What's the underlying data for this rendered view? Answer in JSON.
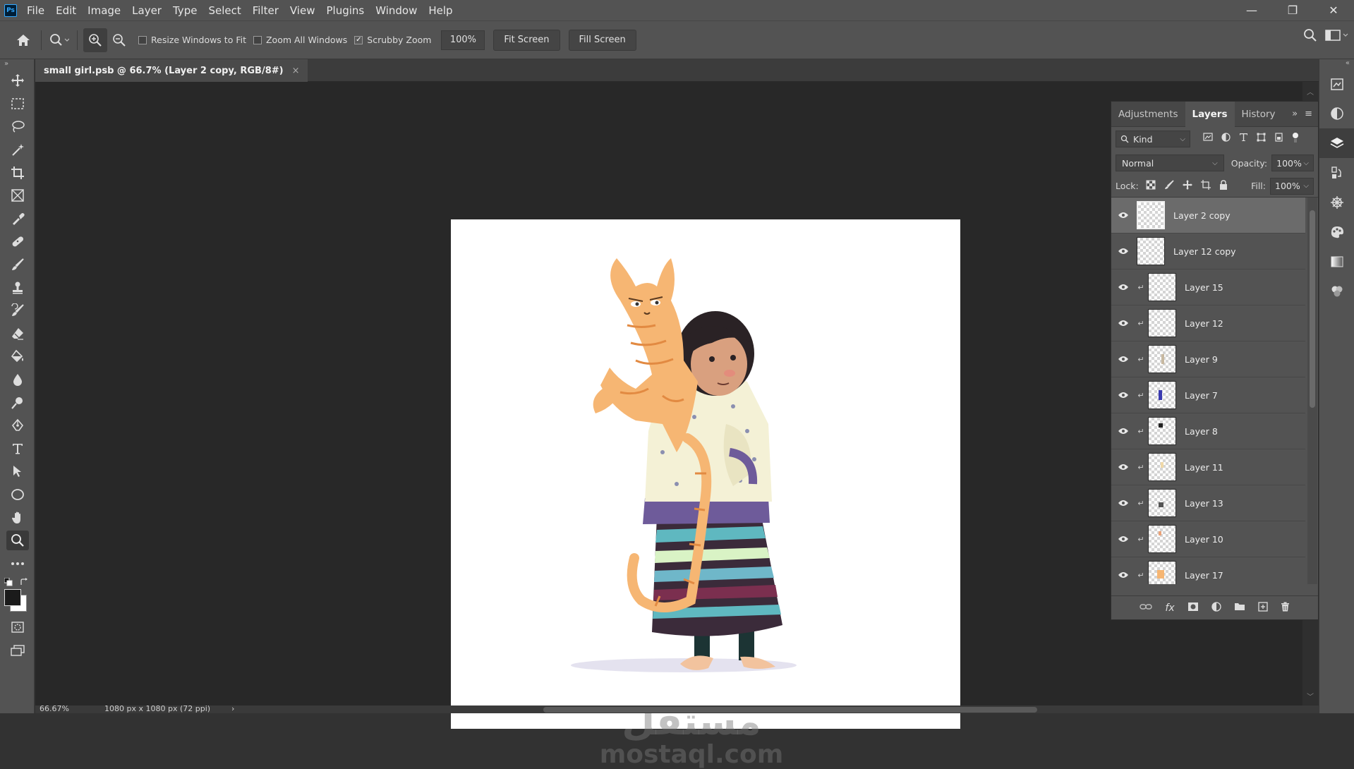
{
  "app": {
    "logo": "Ps",
    "menus": [
      "File",
      "Edit",
      "Image",
      "Layer",
      "Type",
      "Select",
      "Filter",
      "View",
      "Plugins",
      "Window",
      "Help"
    ],
    "window_controls": {
      "minimize": "—",
      "restore": "❐",
      "close": "✕"
    }
  },
  "options": {
    "resize_windows": {
      "label": "Resize Windows to Fit",
      "checked": false
    },
    "zoom_all": {
      "label": "Zoom All Windows",
      "checked": false
    },
    "scrubby_zoom": {
      "label": "Scrubby Zoom",
      "checked": true
    },
    "zoom_value": "100%",
    "fit_screen": "Fit Screen",
    "fill_screen": "Fill Screen"
  },
  "document": {
    "tab_title": "small girl.psb @ 66.7% (Layer 2 copy, RGB/8#)",
    "tab_close": "×"
  },
  "status": {
    "zoom": "66.67%",
    "doc_size": "1080 px x 1080 px (72 ppi)",
    "arrow": "›"
  },
  "watermark": {
    "arabic": "مستقل",
    "latin": "mostaql.com"
  },
  "panel": {
    "tabs": [
      "Adjustments",
      "Layers",
      "History"
    ],
    "active_tab": "Layers",
    "kind_label": "Kind",
    "blend_mode": "Normal",
    "opacity_label": "Opacity:",
    "opacity_value": "100%",
    "lock_label": "Lock:",
    "fill_label": "Fill:",
    "fill_value": "100%",
    "layers": [
      {
        "name": "Layer 2 copy",
        "clipped": false,
        "selected": true
      },
      {
        "name": "Layer 12 copy",
        "clipped": false,
        "selected": false
      },
      {
        "name": "Layer 15",
        "clipped": true,
        "selected": false
      },
      {
        "name": "Layer 12",
        "clipped": true,
        "selected": false
      },
      {
        "name": "Layer 9",
        "clipped": true,
        "selected": false
      },
      {
        "name": "Layer 7",
        "clipped": true,
        "selected": false
      },
      {
        "name": "Layer 8",
        "clipped": true,
        "selected": false
      },
      {
        "name": "Layer 11",
        "clipped": true,
        "selected": false
      },
      {
        "name": "Layer 13",
        "clipped": true,
        "selected": false
      },
      {
        "name": "Layer 10",
        "clipped": true,
        "selected": false
      },
      {
        "name": "Layer 17",
        "clipped": true,
        "selected": false
      }
    ],
    "footer_fx": "fx"
  },
  "colors": {
    "foreground": "#1b1b1b",
    "background": "#ffffff",
    "accent": "#31a8ff"
  }
}
